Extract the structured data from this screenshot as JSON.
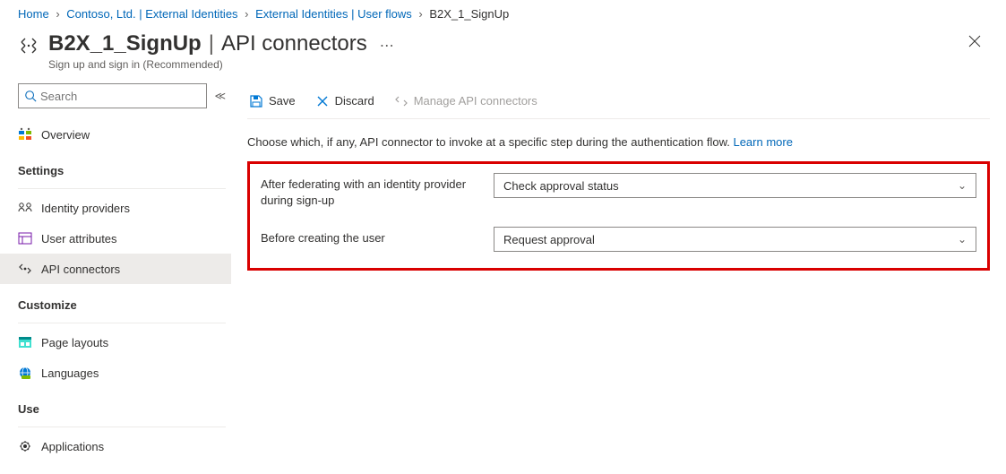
{
  "breadcrumb": {
    "items": [
      {
        "label": "Home"
      },
      {
        "label": "Contoso, Ltd. | External Identities"
      },
      {
        "label": "External Identities | User flows"
      },
      {
        "label": "B2X_1_SignUp"
      }
    ]
  },
  "header": {
    "title_main": "B2X_1_SignUp",
    "title_sub": "API connectors",
    "subtitle": "Sign up and sign in (Recommended)"
  },
  "search": {
    "placeholder": "Search"
  },
  "sidebar": {
    "overview_label": "Overview",
    "groups": [
      {
        "label": "Settings",
        "items": [
          {
            "label": "Identity providers"
          },
          {
            "label": "User attributes"
          },
          {
            "label": "API connectors",
            "active": true
          }
        ]
      },
      {
        "label": "Customize",
        "items": [
          {
            "label": "Page layouts"
          },
          {
            "label": "Languages"
          }
        ]
      },
      {
        "label": "Use",
        "items": [
          {
            "label": "Applications"
          }
        ]
      }
    ]
  },
  "toolbar": {
    "save_label": "Save",
    "discard_label": "Discard",
    "manage_label": "Manage API connectors"
  },
  "main": {
    "intro_text": "Choose which, if any, API connector to invoke at a specific step during the authentication flow. ",
    "learn_more": "Learn more",
    "fields": [
      {
        "label": "After federating with an identity provider during sign-up",
        "value": "Check approval status"
      },
      {
        "label": "Before creating the user",
        "value": "Request approval"
      }
    ]
  }
}
